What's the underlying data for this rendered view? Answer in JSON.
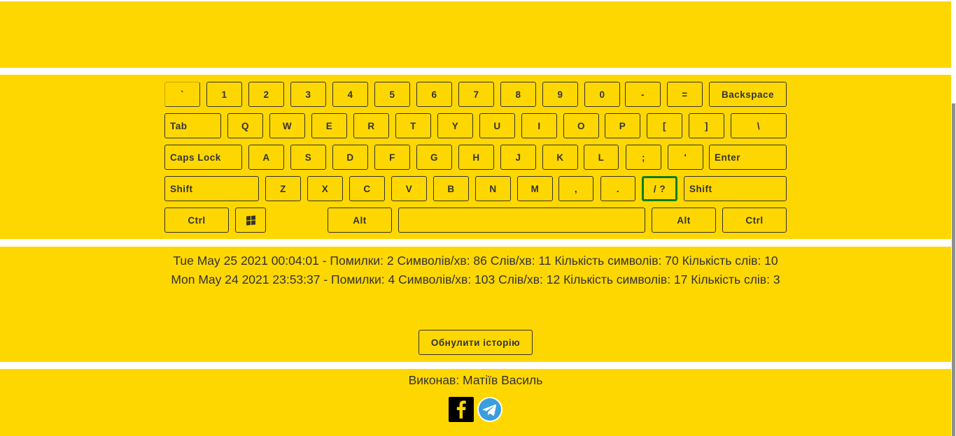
{
  "keyboard": {
    "rows": [
      [
        {
          "id": "backtick",
          "label": "`"
        },
        {
          "id": "1",
          "label": "1"
        },
        {
          "id": "2",
          "label": "2"
        },
        {
          "id": "3",
          "label": "3"
        },
        {
          "id": "4",
          "label": "4"
        },
        {
          "id": "5",
          "label": "5"
        },
        {
          "id": "6",
          "label": "6"
        },
        {
          "id": "7",
          "label": "7"
        },
        {
          "id": "8",
          "label": "8"
        },
        {
          "id": "9",
          "label": "9"
        },
        {
          "id": "0",
          "label": "0"
        },
        {
          "id": "minus",
          "label": "-"
        },
        {
          "id": "equals",
          "label": "="
        },
        {
          "id": "backspace",
          "label": "Backspace"
        }
      ],
      [
        {
          "id": "tab",
          "label": "Tab"
        },
        {
          "id": "q",
          "label": "Q"
        },
        {
          "id": "w",
          "label": "W"
        },
        {
          "id": "e",
          "label": "E"
        },
        {
          "id": "r",
          "label": "R"
        },
        {
          "id": "t",
          "label": "T"
        },
        {
          "id": "y",
          "label": "Y"
        },
        {
          "id": "u",
          "label": "U"
        },
        {
          "id": "i",
          "label": "I"
        },
        {
          "id": "o",
          "label": "O"
        },
        {
          "id": "p",
          "label": "P"
        },
        {
          "id": "bracket-left",
          "label": "["
        },
        {
          "id": "bracket-right",
          "label": "]"
        },
        {
          "id": "backslash",
          "label": "\\"
        }
      ],
      [
        {
          "id": "caps-lock",
          "label": "Caps Lock"
        },
        {
          "id": "a",
          "label": "A"
        },
        {
          "id": "s",
          "label": "S"
        },
        {
          "id": "d",
          "label": "D"
        },
        {
          "id": "f",
          "label": "F"
        },
        {
          "id": "g",
          "label": "G"
        },
        {
          "id": "h",
          "label": "H"
        },
        {
          "id": "j",
          "label": "J"
        },
        {
          "id": "k",
          "label": "K"
        },
        {
          "id": "l",
          "label": "L"
        },
        {
          "id": "semicolon",
          "label": ";"
        },
        {
          "id": "quote",
          "label": "'"
        },
        {
          "id": "enter",
          "label": "Enter"
        }
      ],
      [
        {
          "id": "shift-left",
          "label": "Shift"
        },
        {
          "id": "z",
          "label": "Z"
        },
        {
          "id": "x",
          "label": "X"
        },
        {
          "id": "c",
          "label": "C"
        },
        {
          "id": "v",
          "label": "V"
        },
        {
          "id": "b",
          "label": "B"
        },
        {
          "id": "n",
          "label": "N"
        },
        {
          "id": "m",
          "label": "M"
        },
        {
          "id": "comma",
          "label": ","
        },
        {
          "id": "period",
          "label": "."
        },
        {
          "id": "slash",
          "label": "/ ?",
          "active": true
        },
        {
          "id": "shift-right",
          "label": "Shift"
        }
      ],
      [
        {
          "id": "ctrl-left",
          "label": "Ctrl"
        },
        {
          "id": "windows",
          "label": "",
          "icon": "windows-icon"
        },
        {
          "id": "alt-left",
          "label": "Alt"
        },
        {
          "id": "space",
          "label": ""
        },
        {
          "id": "alt-right",
          "label": "Alt"
        },
        {
          "id": "ctrl-right",
          "label": "Ctrl"
        }
      ]
    ],
    "active_key_color": "#0b7d1c"
  },
  "history": {
    "entries": [
      "Tue May 25 2021 00:04:01 - Помилки: 2 Символів/хв: 86 Слів/хв: 11 Кількість символів: 70 Кількість слів: 10",
      "Mon May 24 2021 23:53:37 - Помилки: 4 Символів/хв: 103 Слів/хв: 12 Кількість символів: 17 Кількість слів: 3"
    ],
    "reset_label": "Обнулити історію"
  },
  "footer": {
    "author": "Виконав: Матіїв Василь",
    "social": [
      {
        "name": "facebook-icon",
        "color": "#000000"
      },
      {
        "name": "telegram-icon",
        "color": "#3a9ede"
      }
    ]
  },
  "colors": {
    "background": "#ffd700",
    "text": "#333333"
  }
}
